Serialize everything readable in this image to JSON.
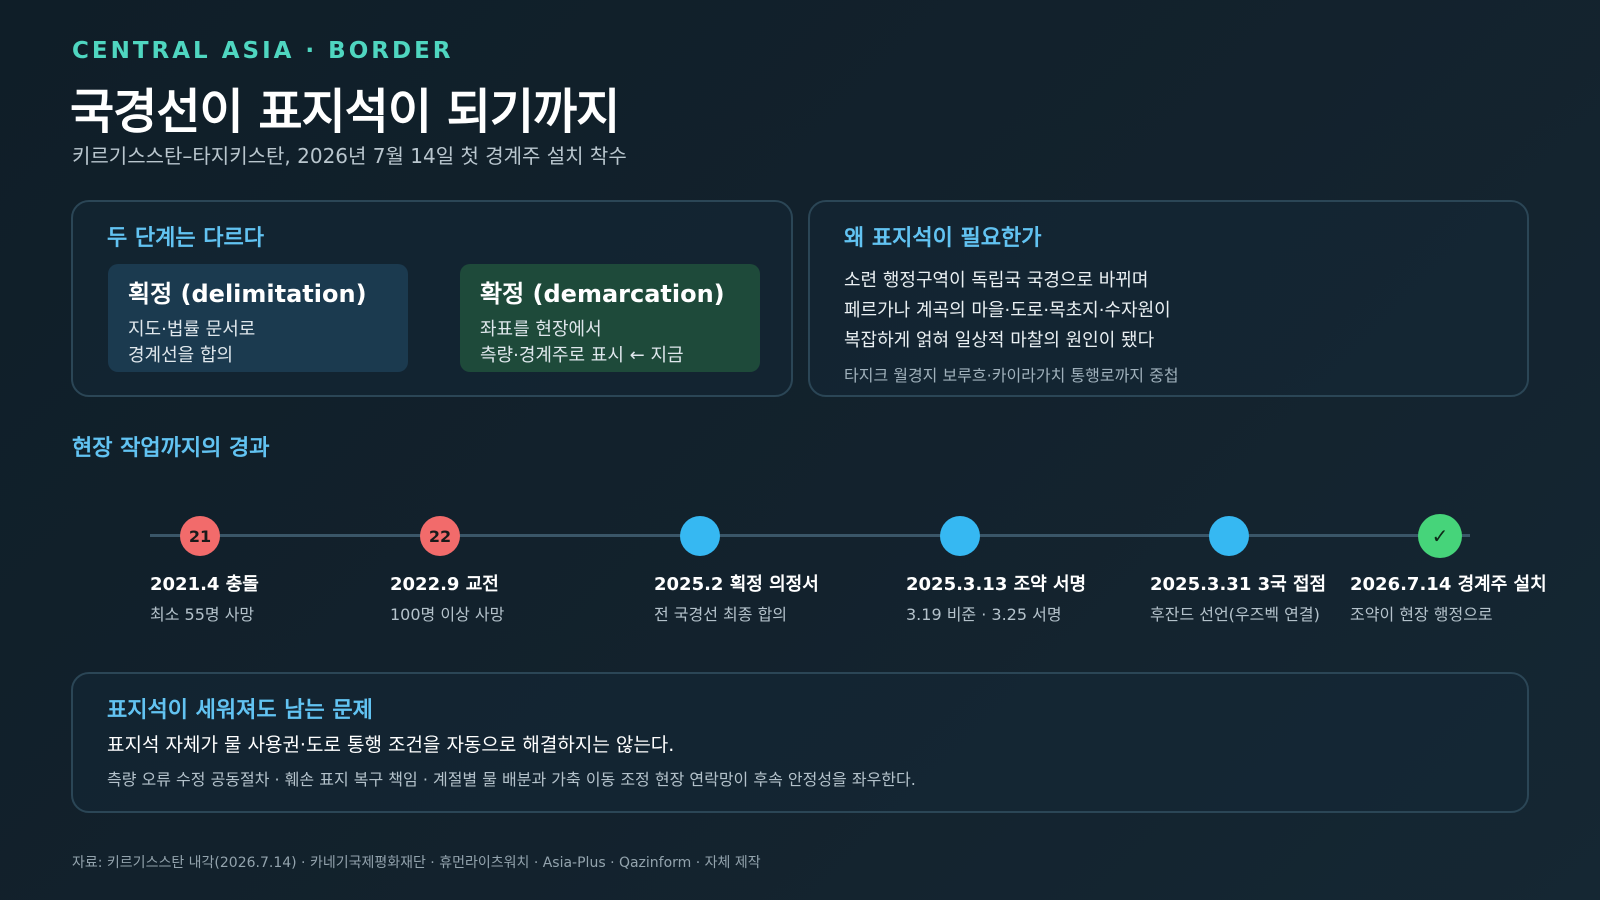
{
  "header": {
    "kicker": "CENTRAL ASIA · BORDER",
    "title": "국경선이 표지석이 되기까지",
    "subtitle": "키르기스스탄–타지키스탄, 2026년 7월 14일 첫 경계주 설치 착수"
  },
  "stages_card": {
    "heading": "두 단계는 다르다",
    "stages": [
      {
        "title": "획정 (delimitation)",
        "line1": "지도·법률 문서로",
        "line2": "경계선을 합의"
      },
      {
        "title": "확정 (demarcation)",
        "line1": "좌표를 현장에서",
        "line2": "측량·경계주로 표시 ← 지금"
      }
    ]
  },
  "why_card": {
    "heading": "왜 표지석이 필요한가",
    "lines": [
      "소련 행정구역이 독립국 국경으로 바뀌며",
      "페르가나 계곡의 마을·도로·목초지·수자원이",
      "복잡하게 얽혀 일상적 마찰의 원인이 됐다"
    ],
    "note": "타지크 월경지 보루흐·카이라가치 통행로까지 중첩"
  },
  "timeline": {
    "title": "현장 작업까지의 경과",
    "events": [
      {
        "marker": "21",
        "label": "2021.4 충돌",
        "detail": "최소 55명 사망",
        "color": "red"
      },
      {
        "marker": "22",
        "label": "2022.9 교전",
        "detail": "100명 이상 사망",
        "color": "red"
      },
      {
        "marker": "",
        "label": "2025.2 획정 의정서",
        "detail": "전 국경선 최종 합의",
        "color": "blue"
      },
      {
        "marker": "",
        "label": "2025.3.13 조약 서명",
        "detail": "3.19 비준 · 3.25 서명",
        "color": "blue"
      },
      {
        "marker": "",
        "label": "2025.3.31 3국 접점",
        "detail": "후잔드 선언(우즈벡 연결)",
        "color": "blue"
      },
      {
        "marker": "✓",
        "label": "2026.7.14 경계주 설치",
        "detail": "조약이 현장 행정으로",
        "color": "green"
      }
    ]
  },
  "issues_card": {
    "heading": "표지석이 세워져도 남는 문제",
    "main": "표지석 자체가 물 사용권·도로 통행 조건을 자동으로 해결하지는 않는다.",
    "note": "측량 오류 수정 공동절차 · 훼손 표지 복구 책임 · 계절별 물 배분과 가축 이동 조정 현장 연락망이 후속 안정성을 좌우한다."
  },
  "source": "자료: 키르기스스탄 내각(2026.7.14) · 카네기국제평화재단 · 휴먼라이츠워치 · Asia-Plus · Qazinform · 자체 제작",
  "colors": {
    "accent_teal": "#4fd6c0",
    "accent_blue": "#62c3f2",
    "marker_red": "#f26b6b",
    "marker_blue": "#36b8f2",
    "marker_green": "#46d47a"
  }
}
